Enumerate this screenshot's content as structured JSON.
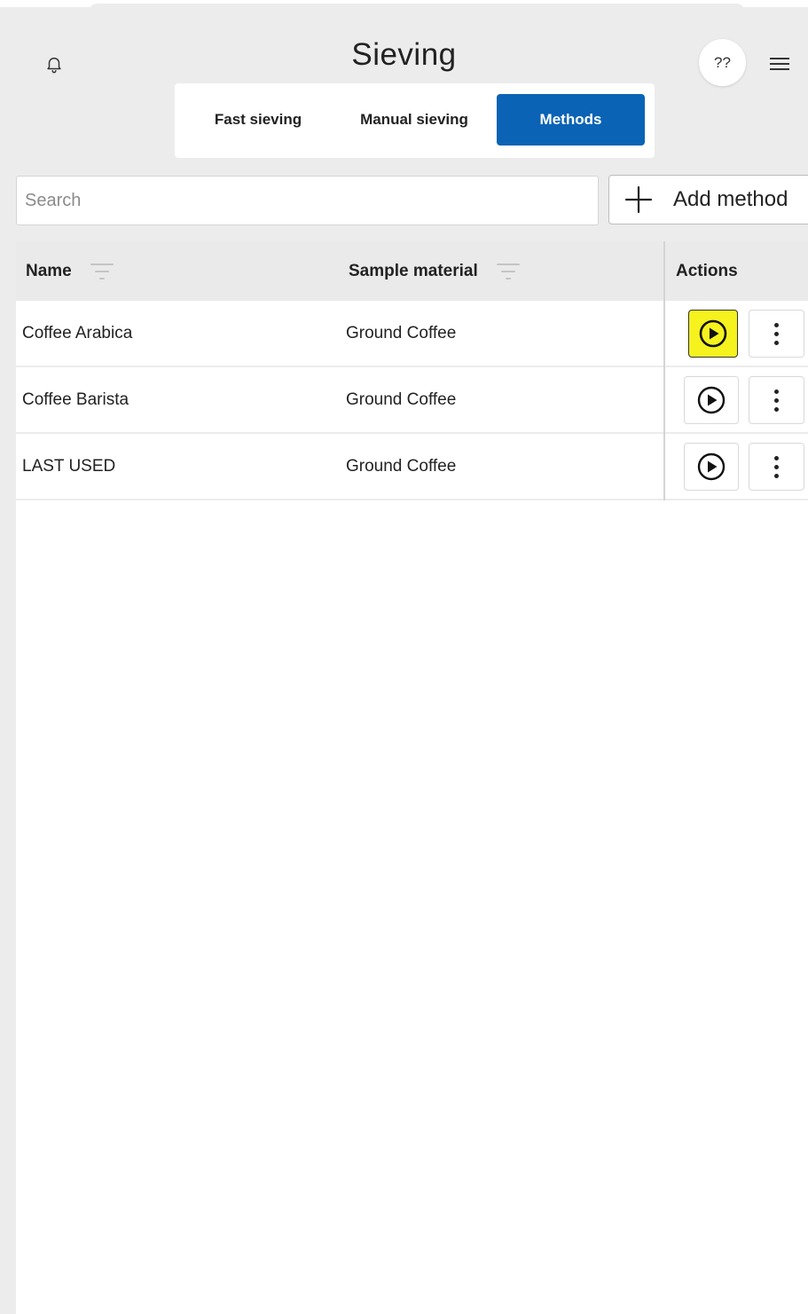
{
  "header": {
    "title": "Sieving",
    "help_label": "??",
    "icons": {
      "notifications": "bell-icon",
      "menu": "hamburger-menu-icon"
    }
  },
  "tabs": [
    {
      "label": "Fast sieving",
      "active": false
    },
    {
      "label": "Manual sieving",
      "active": false
    },
    {
      "label": "Methods",
      "active": true
    }
  ],
  "search": {
    "placeholder": "Search",
    "value": ""
  },
  "add_method": {
    "label": "Add method",
    "icon": "plus-icon"
  },
  "table": {
    "columns": [
      {
        "label": "Name",
        "filterable": true
      },
      {
        "label": "Sample material",
        "filterable": true
      },
      {
        "label": "Actions",
        "filterable": false
      }
    ],
    "rows": [
      {
        "name": "Coffee Arabica",
        "material": "Ground Coffee",
        "play_highlighted": true
      },
      {
        "name": "Coffee Barista",
        "material": "Ground Coffee",
        "play_highlighted": false
      },
      {
        "name": "LAST USED",
        "material": "Ground Coffee",
        "play_highlighted": false
      }
    ]
  },
  "colors": {
    "accent": "#0a63b5",
    "highlight": "#f5f21e",
    "background": "#ececec"
  }
}
